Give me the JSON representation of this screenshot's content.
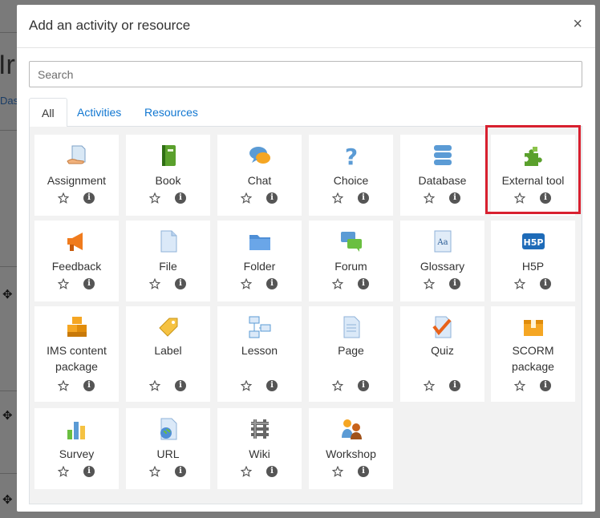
{
  "background": {
    "heading": "Ir",
    "link": "Das"
  },
  "modal": {
    "title": "Add an activity or resource",
    "close_glyph": "×",
    "search_placeholder": "Search",
    "tabs": [
      {
        "label": "All",
        "active": true
      },
      {
        "label": "Activities",
        "active": false
      },
      {
        "label": "Resources",
        "active": false
      }
    ],
    "items": [
      {
        "label": "Assignment",
        "icon": "assignment-icon"
      },
      {
        "label": "Book",
        "icon": "book-icon"
      },
      {
        "label": "Chat",
        "icon": "chat-icon"
      },
      {
        "label": "Choice",
        "icon": "choice-icon"
      },
      {
        "label": "Database",
        "icon": "database-icon"
      },
      {
        "label": "External tool",
        "icon": "external-tool-icon",
        "highlighted": true
      },
      {
        "label": "Feedback",
        "icon": "feedback-icon"
      },
      {
        "label": "File",
        "icon": "file-icon"
      },
      {
        "label": "Folder",
        "icon": "folder-icon"
      },
      {
        "label": "Forum",
        "icon": "forum-icon"
      },
      {
        "label": "Glossary",
        "icon": "glossary-icon"
      },
      {
        "label": "H5P",
        "icon": "h5p-icon"
      },
      {
        "label": "IMS content package",
        "icon": "ims-content-package-icon"
      },
      {
        "label": "Label",
        "icon": "label-icon"
      },
      {
        "label": "Lesson",
        "icon": "lesson-icon"
      },
      {
        "label": "Page",
        "icon": "page-icon"
      },
      {
        "label": "Quiz",
        "icon": "quiz-icon"
      },
      {
        "label": "SCORM package",
        "icon": "scorm-package-icon"
      },
      {
        "label": "Survey",
        "icon": "survey-icon"
      },
      {
        "label": "URL",
        "icon": "url-icon"
      },
      {
        "label": "Wiki",
        "icon": "wiki-icon"
      },
      {
        "label": "Workshop",
        "icon": "workshop-icon"
      }
    ],
    "info_glyph": "i"
  },
  "colors": {
    "link": "#1177d1",
    "highlight": "#d8202f"
  }
}
